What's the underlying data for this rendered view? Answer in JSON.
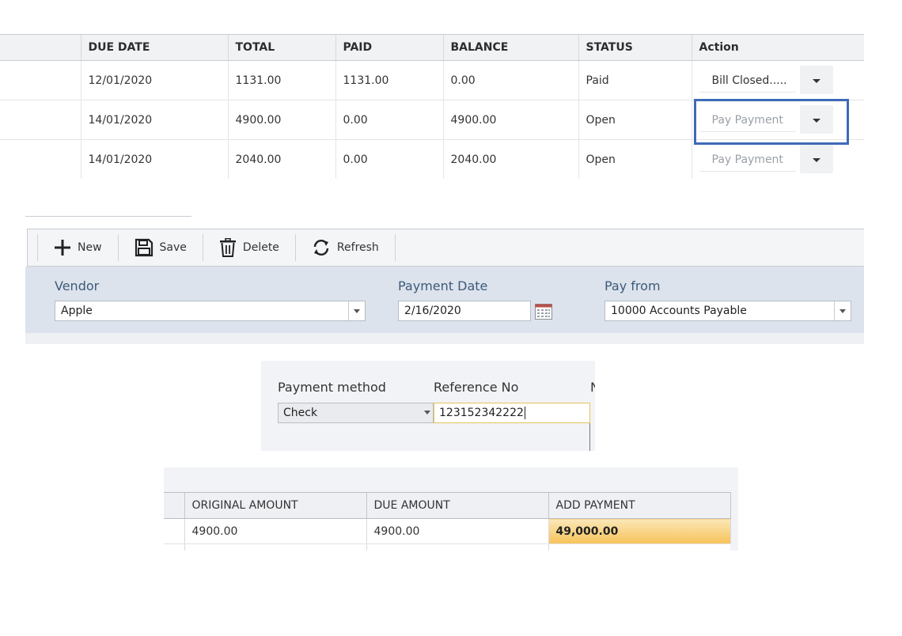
{
  "bills_grid": {
    "columns": [
      "",
      "DUE DATE",
      "TOTAL",
      "PAID",
      "BALANCE",
      "STATUS",
      "Action"
    ],
    "rows": [
      {
        "due_date": "12/01/2020",
        "total": "1131.00",
        "paid": "1131.00",
        "balance": "0.00",
        "status": "Paid",
        "action": "Bill Closed....."
      },
      {
        "due_date": "14/01/2020",
        "total": "4900.00",
        "paid": "0.00",
        "balance": "4900.00",
        "status": "Open",
        "action": "Pay Payment"
      },
      {
        "due_date": "14/01/2020",
        "total": "2040.00",
        "paid": "0.00",
        "balance": "2040.00",
        "status": "Open",
        "action": "Pay Payment"
      }
    ]
  },
  "toolbar": {
    "new_label": "New",
    "save_label": "Save",
    "delete_label": "Delete",
    "refresh_label": "Refresh"
  },
  "form": {
    "vendor_label": "Vendor",
    "vendor_value": "Apple",
    "payment_date_label": "Payment Date",
    "payment_date_value": "2/16/2020",
    "pay_from_label": "Pay from",
    "pay_from_value": "10000 Accounts Payable"
  },
  "payment": {
    "method_label": "Payment method",
    "method_value": "Check",
    "reference_label": "Reference No",
    "reference_value": "123152342222",
    "cut_label": "N"
  },
  "detail_grid": {
    "columns": [
      "",
      "ORIGINAL AMOUNT",
      "DUE AMOUNT",
      "ADD PAYMENT"
    ],
    "rows": [
      {
        "original_amount": "4900.00",
        "due_amount": "4900.00",
        "add_payment": "49,000.00"
      }
    ]
  },
  "colors": {
    "focus_ring": "#3e6ab8",
    "form_background": "#dde3ec",
    "add_payment_highlight": "#f7c25a",
    "reference_focus_border": "#e6c35a"
  },
  "icons": [
    "plus-icon",
    "floppy-disk-icon",
    "trash-icon",
    "refresh-icon",
    "calendar-icon",
    "chevron-down-icon"
  ]
}
